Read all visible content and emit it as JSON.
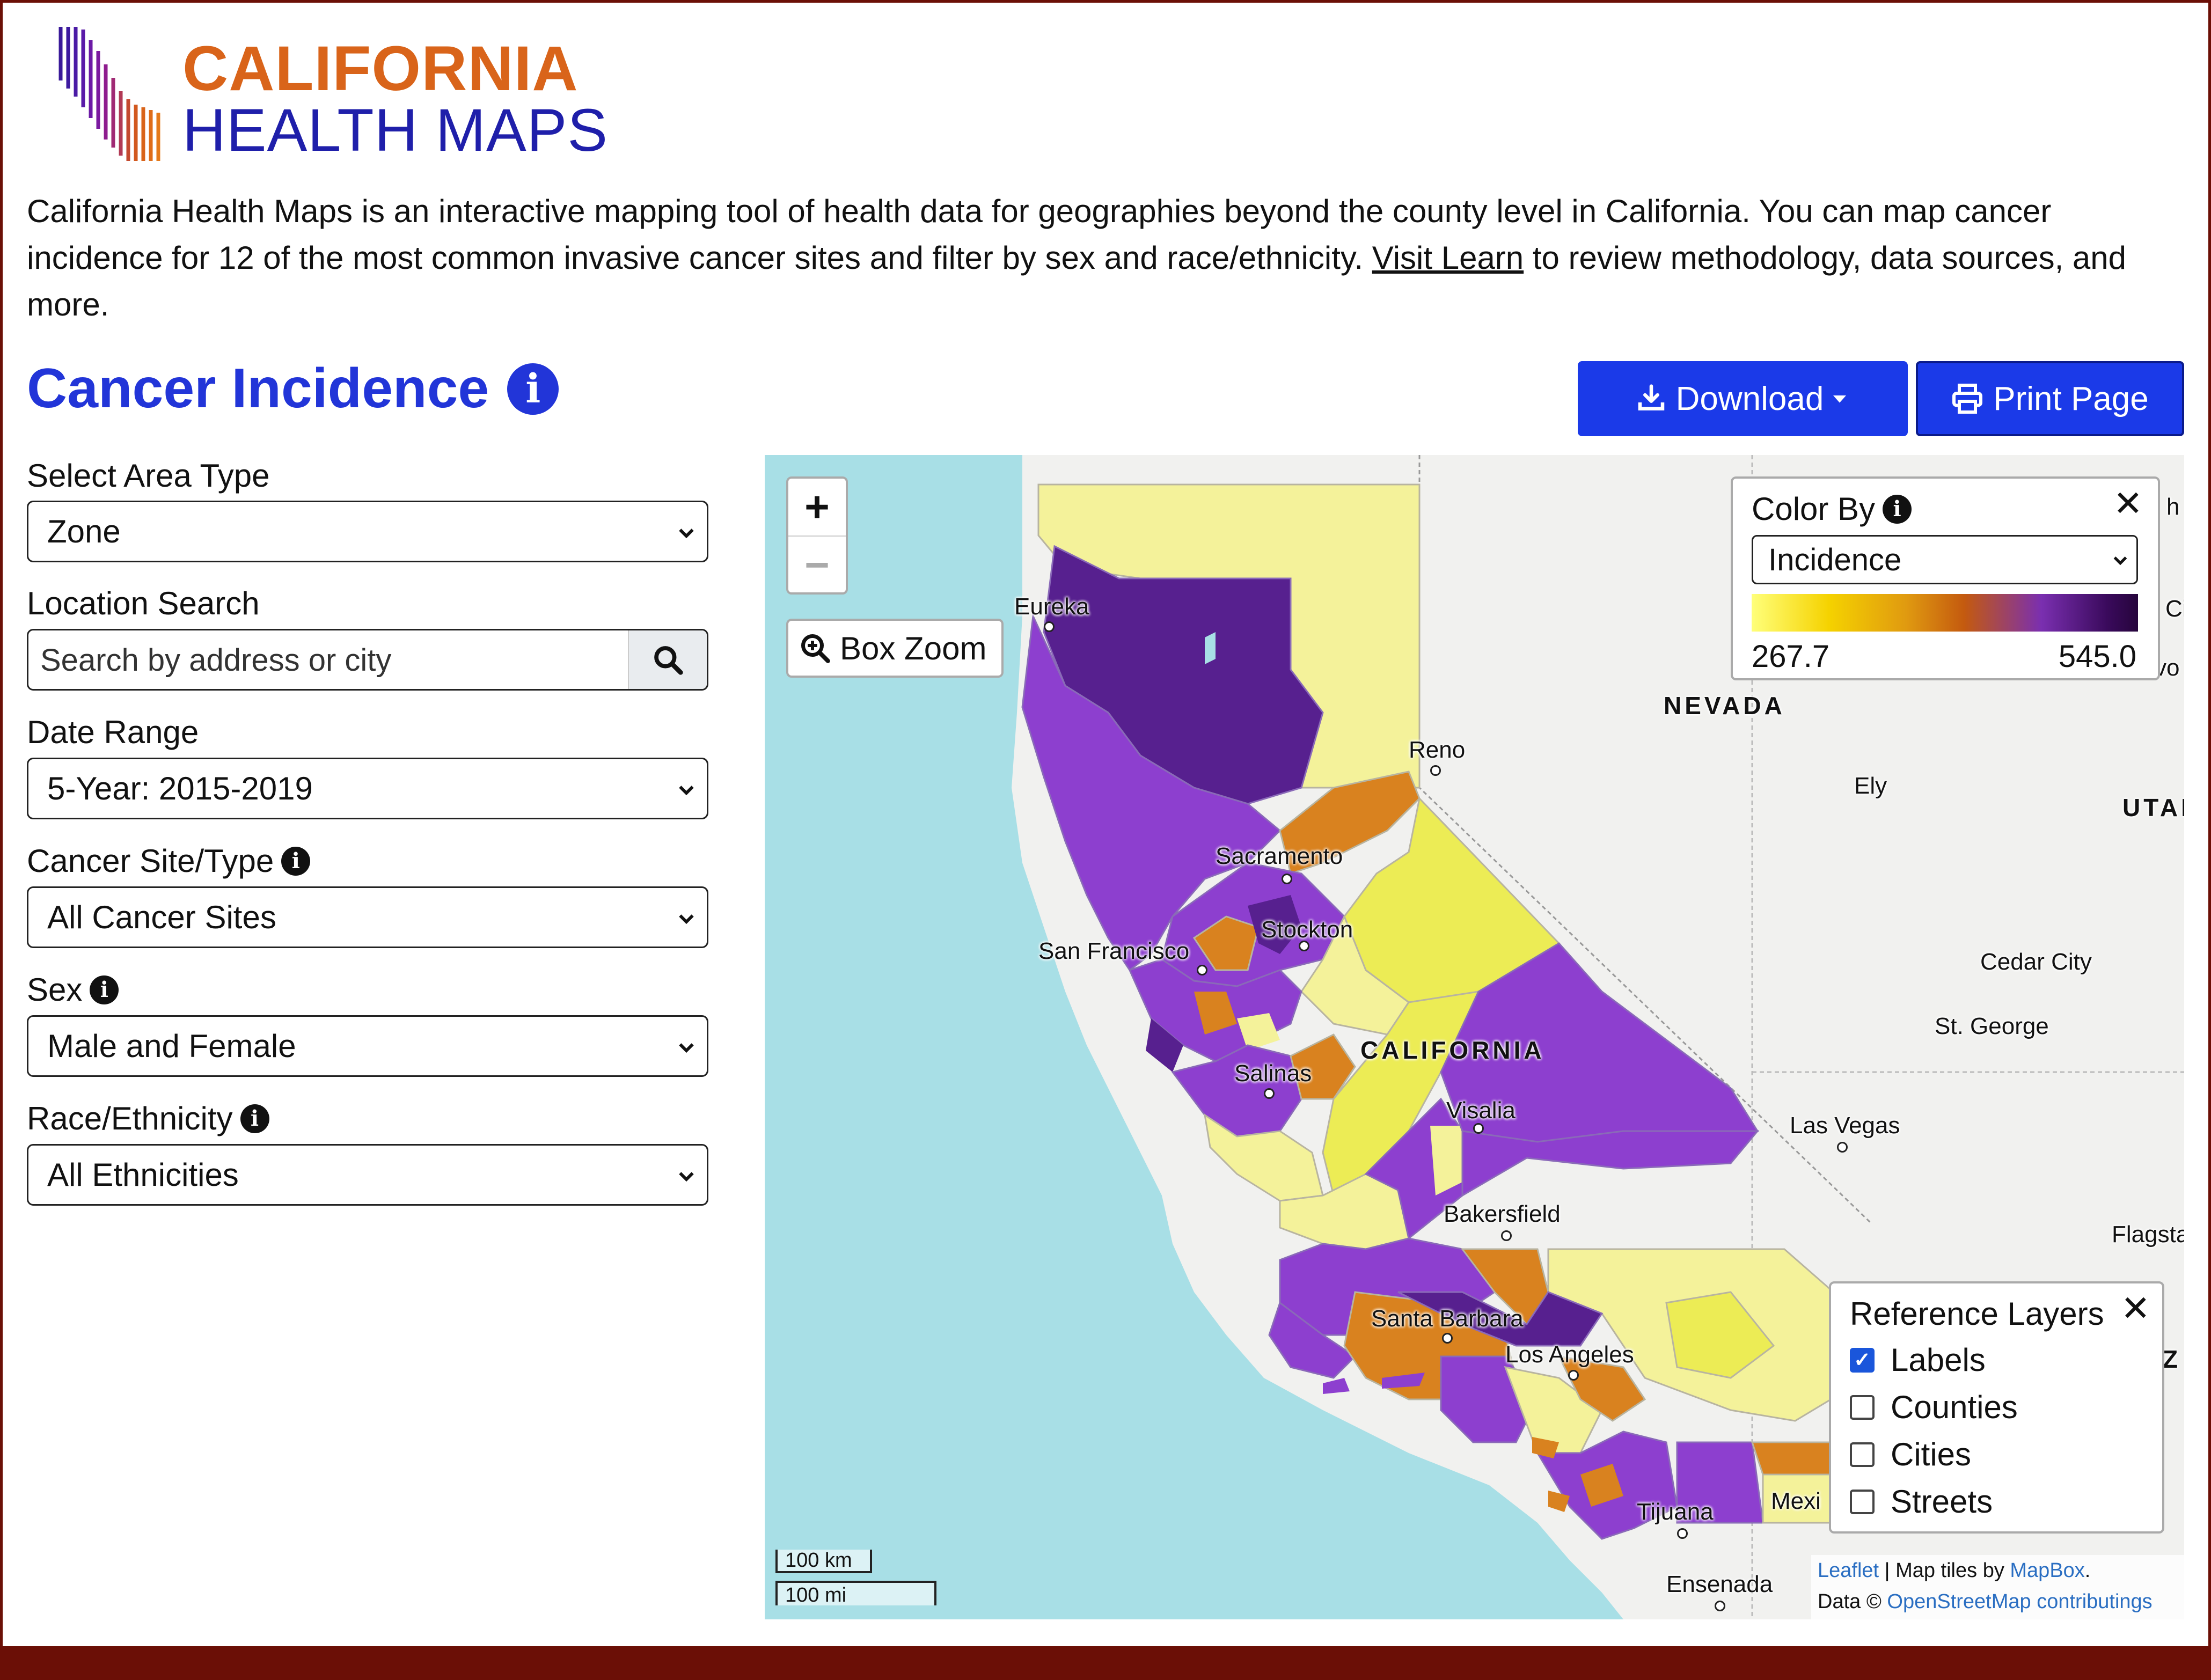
{
  "brand": {
    "title": "CALIFORNIA",
    "subtitle": "HEALTH MAPS"
  },
  "intro": {
    "text_before": "California Health Maps is an interactive mapping tool of health data for geographies beyond the county level in California. You can map cancer incidence for 12 of the most common invasive cancer sites and filter by sex and race/ethnicity. ",
    "link": "Visit Learn",
    "text_after": " to review methodology, data sources, and more."
  },
  "section": {
    "title": "Cancer Incidence"
  },
  "toolbar": {
    "download_label": "Download",
    "print_label": "Print Page"
  },
  "filters": {
    "area_type": {
      "label": "Select Area Type",
      "value": "Zone"
    },
    "location": {
      "label": "Location Search",
      "placeholder": "Search by address or city"
    },
    "date_range": {
      "label": "Date Range",
      "value": "5-Year: 2015-2019"
    },
    "cancer_site": {
      "label": "Cancer Site/Type",
      "value": "All Cancer Sites"
    },
    "sex": {
      "label": "Sex",
      "value": "Male and Female"
    },
    "race": {
      "label": "Race/Ethnicity",
      "value": "All Ethnicities"
    }
  },
  "map": {
    "box_zoom_label": "Box Zoom",
    "zoom_in": "+",
    "zoom_out": "−",
    "color_by": {
      "title": "Color By",
      "value": "Incidence",
      "min": "267.7",
      "max": "545.0",
      "gradient_colors": [
        "#ffff7a",
        "#f5d200",
        "#e09a10",
        "#c45a0f",
        "#7a2fb0",
        "#3a0a5c",
        "#26053c"
      ]
    },
    "reference_layers": {
      "title": "Reference Layers",
      "items": [
        {
          "label": "Labels",
          "checked": true
        },
        {
          "label": "Counties",
          "checked": false
        },
        {
          "label": "Cities",
          "checked": false
        },
        {
          "label": "Streets",
          "checked": false
        }
      ]
    },
    "scale": {
      "km": "100 km",
      "mi": "100 mi"
    },
    "attribution": {
      "leaflet": "Leaflet",
      "sep": " | Map tiles by ",
      "mapbox": "MapBox",
      "period": ".",
      "data_prefix": "Data © ",
      "osm": "OpenStreetMap contributings"
    },
    "labels": {
      "eureka": "Eureka",
      "reno": "Reno",
      "nevada": "NEVADA",
      "ely": "Ely",
      "utah": "UTAI",
      "sacramento": "Sacramento",
      "stockton": "Stockton",
      "san_francisco": "San Francisco",
      "cedar_city": "Cedar City",
      "st_george": "St. George",
      "california": "CALIFORNIA",
      "salinas": "Salinas",
      "visalia": "Visalia",
      "las_vegas": "Las Vegas",
      "bakersfield": "Bakersfield",
      "flagstaff": "Flagsta",
      "santa_barbara": "Santa Barbara",
      "los_angeles": "Los Angeles",
      "tijuana": "Tijuana",
      "mexicali": "Mexi",
      "ensenada": "Ensenada",
      "ci": "Ci",
      "vo": "vo",
      "z": "Z",
      "h": "h"
    },
    "colors": {
      "purple": "#8d3fcf",
      "dark_purple": "#57208f",
      "orange": "#d9821f",
      "yellow": "#ecec55",
      "pale_yellow": "#f4f29a",
      "water": "#a8dfe6",
      "land": "#f1f1ef"
    }
  },
  "footer": {
    "bar_color": "#6b0f06"
  }
}
